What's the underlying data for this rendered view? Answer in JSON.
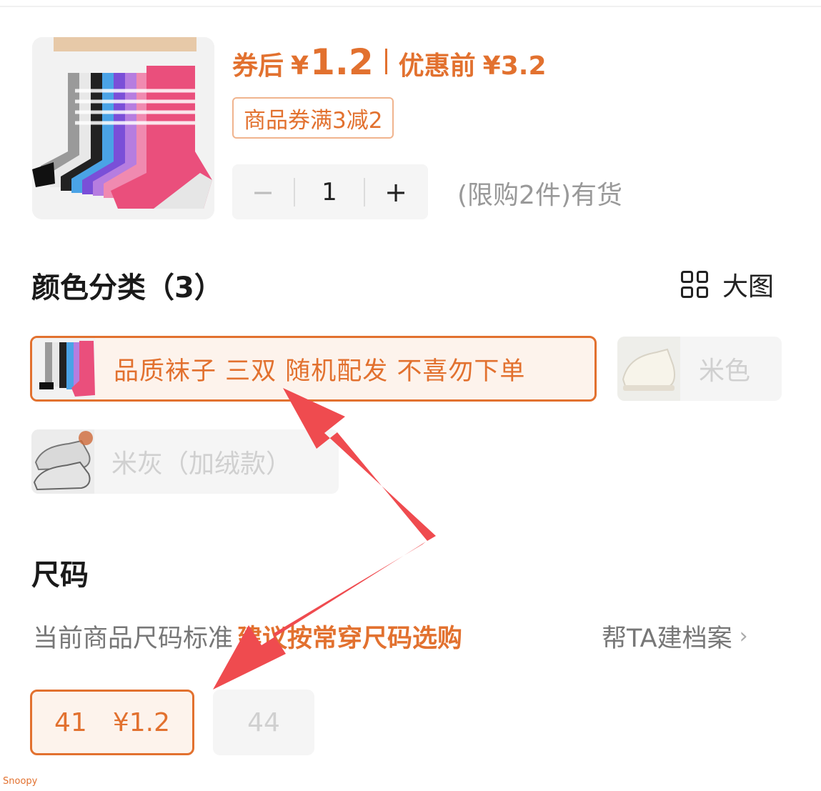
{
  "price": {
    "after_coupon_label": "券后",
    "currency": "¥",
    "after_coupon_amount": "1.2",
    "before_label": "优惠前",
    "before_amount": "¥3.2"
  },
  "coupon_tag": "商品券满3减2",
  "quantity": {
    "minus": "−",
    "value": "1",
    "plus": "+",
    "stock_text": "(限购2件)有货"
  },
  "color_section": {
    "title": "颜色分类（3）",
    "big_picture_label": "大图",
    "options": [
      {
        "label": "品质袜子 三双 随机配发 不喜勿下单",
        "selected": true
      },
      {
        "label": "米色",
        "selected": false
      },
      {
        "label": "米灰（加绒款）",
        "selected": false
      }
    ]
  },
  "size_section": {
    "title": "尺码",
    "hint_prefix": "当前商品尺码标准",
    "hint_highlight": "建议按常穿尺码选购",
    "profile_link": "帮TA建档案",
    "options": [
      {
        "size": "41",
        "price": "¥1.2",
        "selected": true
      },
      {
        "size": "44",
        "selected": false
      }
    ]
  },
  "watermark": "Snoopy",
  "icons": {
    "grid": "grid-icon",
    "chevron": "chevron-right-icon",
    "arrow": "red-annotation-arrow-icon"
  },
  "colors": {
    "accent": "#e2712f",
    "arrow": "#ef4b4f",
    "disabled_text": "#d0d0d0"
  }
}
